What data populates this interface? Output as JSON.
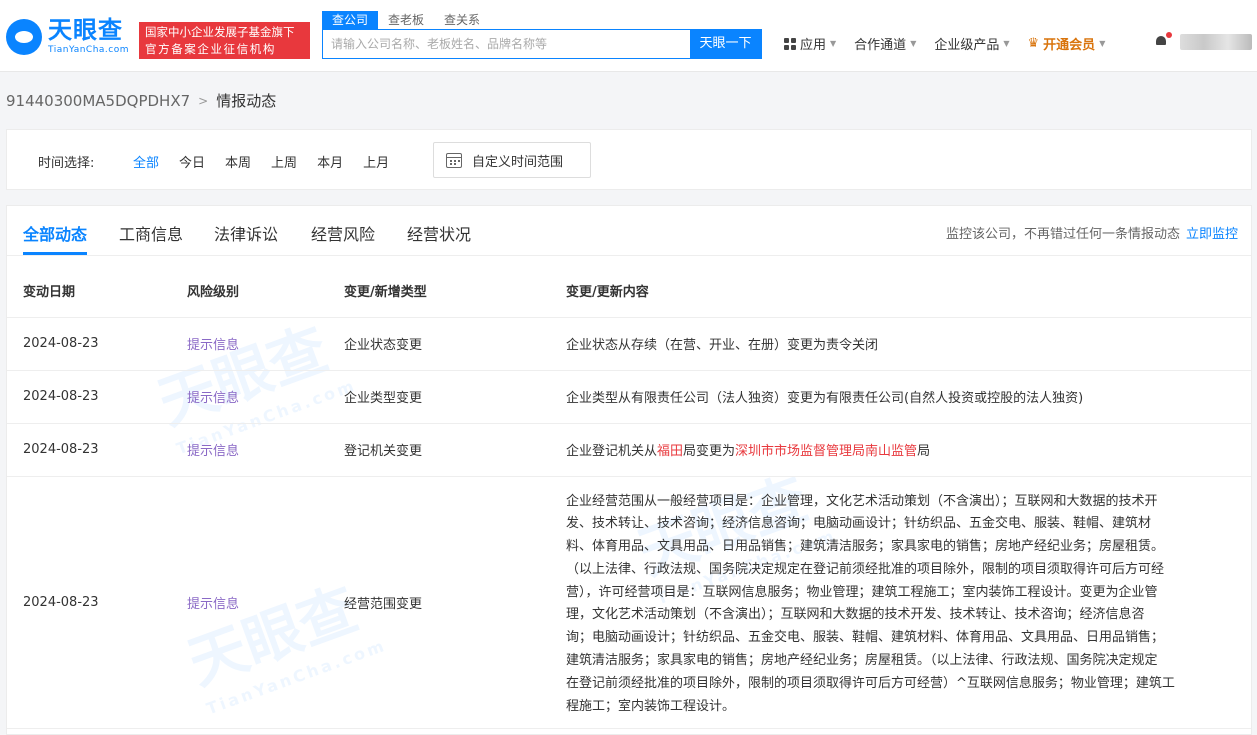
{
  "header": {
    "logo_cn": "天眼查",
    "logo_en": "TianYanCha.com",
    "badge_line1": "国家中小企业发展子基金旗下",
    "badge_line2": "官方备案企业征信机构",
    "search_tabs": [
      "查公司",
      "查老板",
      "查关系"
    ],
    "search_placeholder": "请输入公司名称、老板姓名、品牌名称等",
    "search_button": "天眼一下",
    "nav": {
      "apps": "应用",
      "channel": "合作通道",
      "enterprise": "企业级产品",
      "vip": "开通会员"
    }
  },
  "breadcrumb": {
    "company_code": "91440300MA5DQPDHX7",
    "current": "情报动态"
  },
  "filter": {
    "label": "时间选择:",
    "options": [
      "全部",
      "今日",
      "本周",
      "上周",
      "本月",
      "上月"
    ],
    "custom_range": "自定义时间范围"
  },
  "tabs": [
    "全部动态",
    "工商信息",
    "法律诉讼",
    "经营风险",
    "经营状况"
  ],
  "monitor": {
    "text": "监控该公司，不再错过任何一条情报动态",
    "link": "立即监控"
  },
  "table": {
    "headers": [
      "变动日期",
      "风险级别",
      "变更/新增类型",
      "变更/更新内容"
    ],
    "rows": [
      {
        "date": "2024-08-23",
        "risk": "提示信息",
        "type": "企业状态变更",
        "content": "企业状态从存续（在营、开业、在册）变更为责令关闭"
      },
      {
        "date": "2024-08-23",
        "risk": "提示信息",
        "type": "企业类型变更",
        "content": "企业类型从有限责任公司（法人独资）变更为有限责任公司(自然人投资或控股的法人独资)"
      },
      {
        "date": "2024-08-23",
        "risk": "提示信息",
        "type": "登记机关变更",
        "content_pre": "企业登记机关从",
        "content_old": "福田",
        "content_mid": "局变更为",
        "content_new": "深圳市市场监督管理局南山监管",
        "content_post": "局"
      },
      {
        "date": "2024-08-23",
        "risk": "提示信息",
        "type": "经营范围变更",
        "content_lines": [
          "企业经营范围从一般经营项目是：企业管理，文化艺术活动策划（不含演出）；互联网和大数据的技术开",
          "发、技术转让、技术咨询；经济信息咨询；电脑动画设计；针纺织品、五金交电、服装、鞋帽、建筑材",
          "料、体育用品、文具用品、日用品销售；建筑清洁服务；家具家电的销售；房地产经纪业务；房屋租赁。",
          "（以上法律、行政法规、国务院决定规定在登记前须经批准的项目除外，限制的项目须取得许可后方可经",
          "营），许可经营项目是：互联网信息服务；物业管理；建筑工程施工；室内装饰工程设计。变更为企业管",
          "理，文化艺术活动策划（不含演出）；互联网和大数据的技术开发、技术转让、技术咨询；经济信息咨",
          "询；电脑动画设计；针纺织品、五金交电、服装、鞋帽、建筑材料、体育用品、文具用品、日用品销售；",
          "建筑清洁服务；家具家电的销售；房地产经纪业务；房屋租赁。（以上法律、行政法规、国务院决定规定",
          "在登记前须经批准的项目除外，限制的项目须取得许可后方可经营）^互联网信息服务；物业管理；建筑工",
          "程施工；室内装饰工程设计。"
        ]
      }
    ]
  },
  "colors": {
    "accent": "#0a84ff",
    "badge": "#e8383d",
    "risk": "#8a69c6",
    "vip": "#d9740c"
  }
}
